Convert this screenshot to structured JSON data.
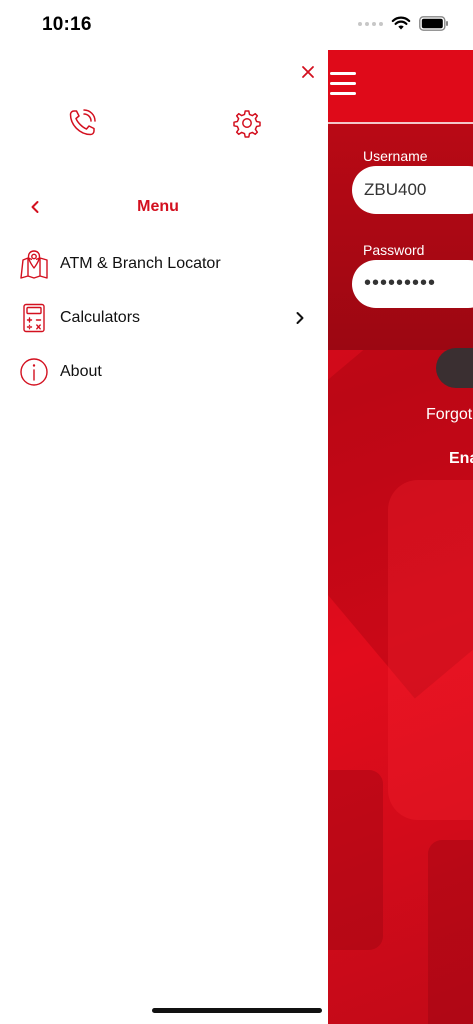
{
  "status_bar": {
    "time": "10:16"
  },
  "drawer": {
    "menu_title": "Menu",
    "items": [
      {
        "label": "ATM & Branch Locator",
        "icon": "map-pin-icon",
        "has_submenu": false
      },
      {
        "label": "Calculators",
        "icon": "calculator-icon",
        "has_submenu": true
      },
      {
        "label": "About",
        "icon": "info-icon",
        "has_submenu": false
      }
    ]
  },
  "login": {
    "username_label": "Username",
    "username_value": "ZBU400",
    "password_label": "Password",
    "password_value": "•••••••••",
    "forgot_text": "Forgot",
    "enable_text": "Ena"
  },
  "colors": {
    "brand_red": "#d3101f",
    "header_red": "#df0a19",
    "panel_red": "#a80812",
    "button_dark": "#3a2f31"
  }
}
